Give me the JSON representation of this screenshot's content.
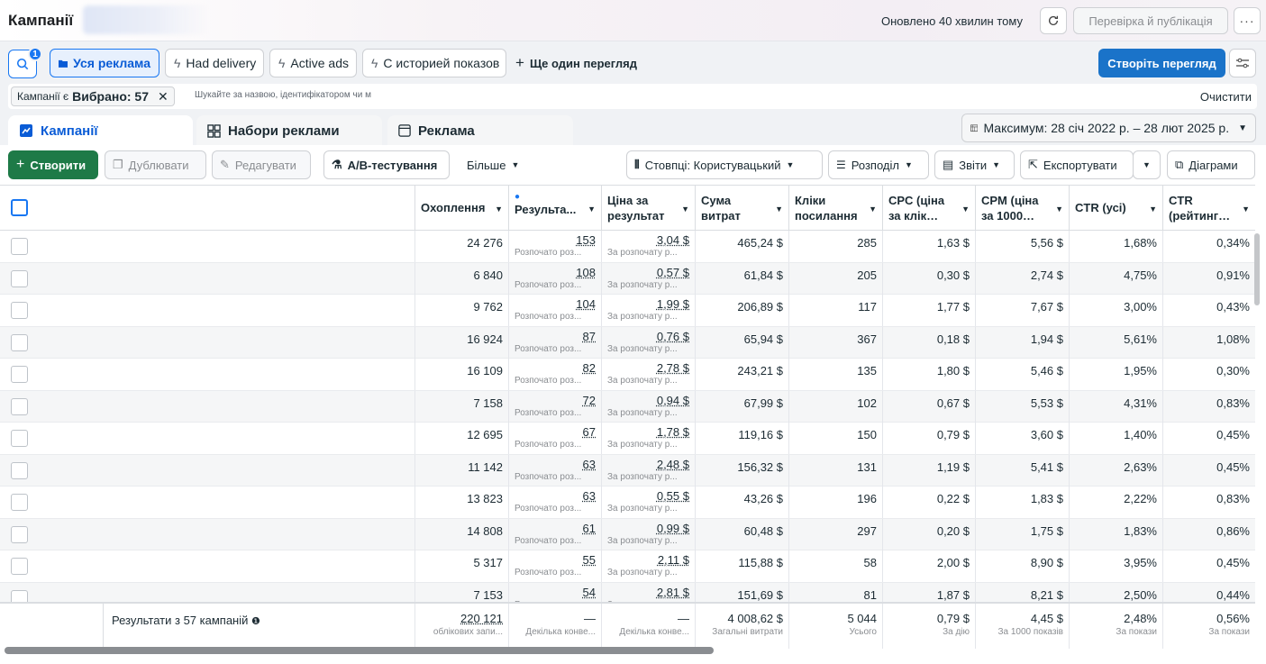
{
  "header": {
    "title": "Кампанії",
    "updated": "Оновлено 40 хвилин тому",
    "publish_label": "Перевірка й публікація",
    "more_label": "···"
  },
  "views": {
    "search_badge": "1",
    "tabs": [
      "Уся реклама",
      "Had delivery",
      "Active ads",
      "С историей показов"
    ],
    "add_view": "Ще один перегляд",
    "create_view": "Створіть перегляд"
  },
  "filter": {
    "chip_prefix": "Кампанії є",
    "chip_value": "Вибрано: 57",
    "placeholder": "Шукайте за назвою, ідентифікатором чи м",
    "clear": "Очистити"
  },
  "tabs": [
    "Кампанії",
    "Набори реклами",
    "Реклама"
  ],
  "date_range": "Максимум: 28 січ 2022 р. – 28 лют 2025 р.",
  "toolbar": {
    "create": "Створити",
    "duplicate": "Дублювати",
    "edit": "Редагувати",
    "ab_test": "A/B-тестування",
    "more": "Більше",
    "columns": "Стовпці: Користувацький",
    "breakdown": "Розподіл",
    "reports": "Звіти",
    "export": "Експортувати",
    "charts": "Діаграми"
  },
  "columns": [
    "Охоплення",
    "Результа...",
    "Ціна за результат",
    "Сума витрат",
    "Кліки посилання",
    "CPC (ціна за клік…",
    "CPM (ціна за 1000…",
    "CTR (усі)",
    "CTR (рейтинг…"
  ],
  "result_sub": "Розпочато роз...",
  "cost_sub": "За розпочату р...",
  "rows": [
    {
      "reach": "24 276",
      "results": "153",
      "cost": "3,04 $",
      "spend": "465,24 $",
      "clicks": "285",
      "cpc": "1,63 $",
      "cpm": "5,56 $",
      "ctr_all": "1,68%",
      "ctr_link": "0,34%"
    },
    {
      "reach": "6 840",
      "results": "108",
      "cost": "0,57 $",
      "spend": "61,84 $",
      "clicks": "205",
      "cpc": "0,30 $",
      "cpm": "2,74 $",
      "ctr_all": "4,75%",
      "ctr_link": "0,91%"
    },
    {
      "reach": "9 762",
      "results": "104",
      "cost": "1,99 $",
      "spend": "206,89 $",
      "clicks": "117",
      "cpc": "1,77 $",
      "cpm": "7,67 $",
      "ctr_all": "3,00%",
      "ctr_link": "0,43%"
    },
    {
      "reach": "16 924",
      "results": "87",
      "cost": "0,76 $",
      "spend": "65,94 $",
      "clicks": "367",
      "cpc": "0,18 $",
      "cpm": "1,94 $",
      "ctr_all": "5,61%",
      "ctr_link": "1,08%"
    },
    {
      "reach": "16 109",
      "results": "82",
      "cost": "2,78 $",
      "spend": "243,21 $",
      "clicks": "135",
      "cpc": "1,80 $",
      "cpm": "5,46 $",
      "ctr_all": "1,95%",
      "ctr_link": "0,30%"
    },
    {
      "reach": "7 158",
      "results": "72",
      "cost": "0,94 $",
      "spend": "67,99 $",
      "clicks": "102",
      "cpc": "0,67 $",
      "cpm": "5,53 $",
      "ctr_all": "4,31%",
      "ctr_link": "0,83%"
    },
    {
      "reach": "12 695",
      "results": "67",
      "cost": "1,78 $",
      "spend": "119,16 $",
      "clicks": "150",
      "cpc": "0,79 $",
      "cpm": "3,60 $",
      "ctr_all": "1,40%",
      "ctr_link": "0,45%"
    },
    {
      "reach": "11 142",
      "results": "63",
      "cost": "2,48 $",
      "spend": "156,32 $",
      "clicks": "131",
      "cpc": "1,19 $",
      "cpm": "5,41 $",
      "ctr_all": "2,63%",
      "ctr_link": "0,45%"
    },
    {
      "reach": "13 823",
      "results": "63",
      "cost": "0,55 $",
      "spend": "43,26 $",
      "clicks": "196",
      "cpc": "0,22 $",
      "cpm": "1,83 $",
      "ctr_all": "2,22%",
      "ctr_link": "0,83%"
    },
    {
      "reach": "14 808",
      "results": "61",
      "cost": "0,99 $",
      "spend": "60,48 $",
      "clicks": "297",
      "cpc": "0,20 $",
      "cpm": "1,75 $",
      "ctr_all": "1,83%",
      "ctr_link": "0,86%"
    },
    {
      "reach": "5 317",
      "results": "55",
      "cost": "2,11 $",
      "spend": "115,88 $",
      "clicks": "58",
      "cpc": "2,00 $",
      "cpm": "8,90 $",
      "ctr_all": "3,95%",
      "ctr_link": "0,45%"
    },
    {
      "reach": "7 153",
      "results": "54",
      "cost": "2,81 $",
      "spend": "151,69 $",
      "clicks": "81",
      "cpc": "1,87 $",
      "cpm": "8,21 $",
      "ctr_all": "2,50%",
      "ctr_link": "0,44%"
    }
  ],
  "summary": {
    "label": "Результати з 57 кампаній",
    "reach": "220 121",
    "reach_sub": "облікових запи...",
    "results": "—",
    "results_sub": "Декілька конве...",
    "cost": "—",
    "cost_sub": "Декілька конве...",
    "spend": "4 008,62 $",
    "spend_sub": "Загальні витрати",
    "clicks": "5 044",
    "clicks_sub": "Усього",
    "cpc": "0,79 $",
    "cpc_sub": "За дію",
    "cpm": "4,45 $",
    "cpm_sub": "За 1000 показів",
    "ctr_all": "2,48%",
    "ctr_all_sub": "За покази",
    "ctr_link": "0,56%",
    "ctr_link_sub": "За покази"
  }
}
